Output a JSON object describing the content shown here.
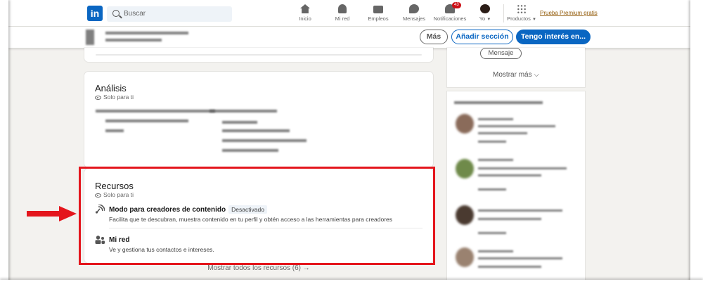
{
  "nav": {
    "logo": "in",
    "search_placeholder": "Buscar",
    "items": [
      {
        "label": "Inicio",
        "icon": "home-icon"
      },
      {
        "label": "Mi red",
        "icon": "network-icon"
      },
      {
        "label": "Empleos",
        "icon": "briefcase-icon"
      },
      {
        "label": "Mensajes",
        "icon": "messaging-icon"
      },
      {
        "label": "Notificaciones",
        "icon": "bell-icon",
        "badge": "43"
      },
      {
        "label": "Yo",
        "icon": "avatar-icon"
      },
      {
        "label": "Productos",
        "icon": "grid-icon"
      }
    ],
    "premium": "Prueba Premium gratis"
  },
  "profile_bar": {
    "more": "Más",
    "add_section": "Añadir sección",
    "open_to": "Tengo interés en..."
  },
  "analysis": {
    "title": "Análisis",
    "visibility": "Solo para ti"
  },
  "resources": {
    "title": "Recursos",
    "visibility": "Solo para ti",
    "items": [
      {
        "title": "Modo para creadores de contenido",
        "status": "Desactivado",
        "description": "Facilita que te descubran, muestra contenido en tu perfil y obtén acceso a las herramientas para creadores",
        "icon": "creator-mode-icon"
      },
      {
        "title": "Mi red",
        "description": "Ve y gestiona tus contactos e intereses.",
        "icon": "people-icon"
      }
    ],
    "show_all": "Mostrar todos los recursos (6) →"
  },
  "sidebar": {
    "message_button": "Mensaje",
    "show_more": "Mostrar más ⌵"
  },
  "colors": {
    "linkedin_blue": "#0a66c2",
    "highlight_red": "#e4161d",
    "premium_gold": "#915907",
    "background": "#f3f2ef"
  }
}
